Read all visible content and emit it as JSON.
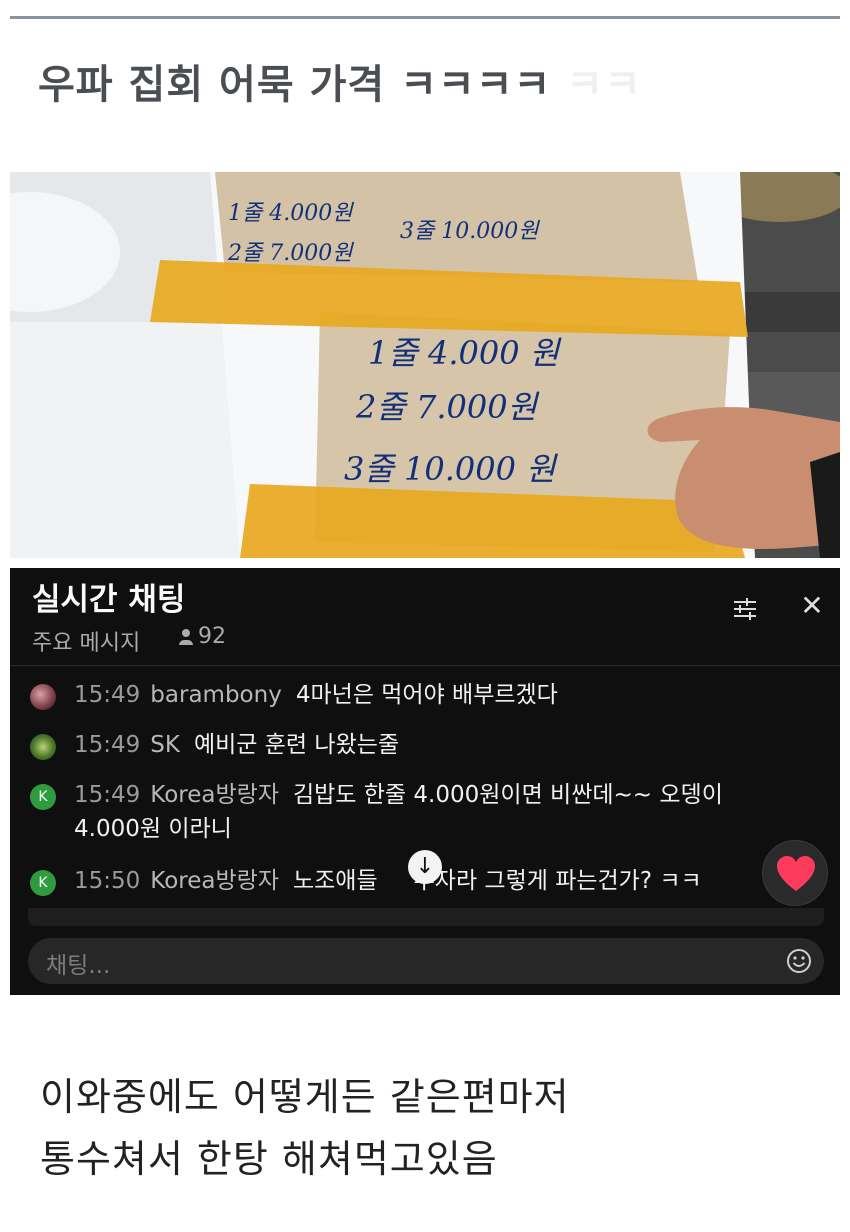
{
  "post": {
    "title": "우파 집회 어묵 가격 ㅋㅋㅋㅋ",
    "title_ghost": "ㅋㅋ"
  },
  "photo": {
    "sign_upper": {
      "line1": "1줄 4.000원",
      "line2": "2줄 7.000원",
      "line3": "3줄 10.000원"
    },
    "sign_lower": {
      "line1": "1줄 4.000 원",
      "line2": "2줄 7.000원",
      "line3": "3줄 10.000 원"
    }
  },
  "chat": {
    "title": "실시간 채팅",
    "mode": "주요 메시지",
    "viewers": "92",
    "messages": [
      {
        "time": "15:49",
        "author": "barambony",
        "text": "4마넌은 먹어야 배부르겠다",
        "avatar": "photo"
      },
      {
        "time": "15:49",
        "author": "SK",
        "text": "예비군 훈련 나왔는줄",
        "avatar": "photo"
      },
      {
        "time": "15:49",
        "author": "Korea방랑자",
        "text": "김밥도 한줄 4.000원이면 비싼데~~ 오뎅이",
        "text2": "4.000원 이라니",
        "avatar": "K"
      },
      {
        "time": "15:50",
        "author": "Korea방랑자",
        "text": "노조애들",
        "text_after": "부자라 그렇게 파는건가? ㅋㅋ",
        "avatar": "K"
      }
    ],
    "scroll_arrow": "↓",
    "input_placeholder": "채팅..."
  },
  "comment": {
    "line1": "이와중에도 어떻게든 같은편마저",
    "line2": "통수쳐서 한탕 해쳐먹고있음"
  },
  "colors": {
    "chat_bg": "#0f0f0f",
    "avatar_green": "#2e9b3f",
    "heart": "#ff3b5c",
    "ink": "#12307a",
    "tape": "#e8a81f"
  }
}
